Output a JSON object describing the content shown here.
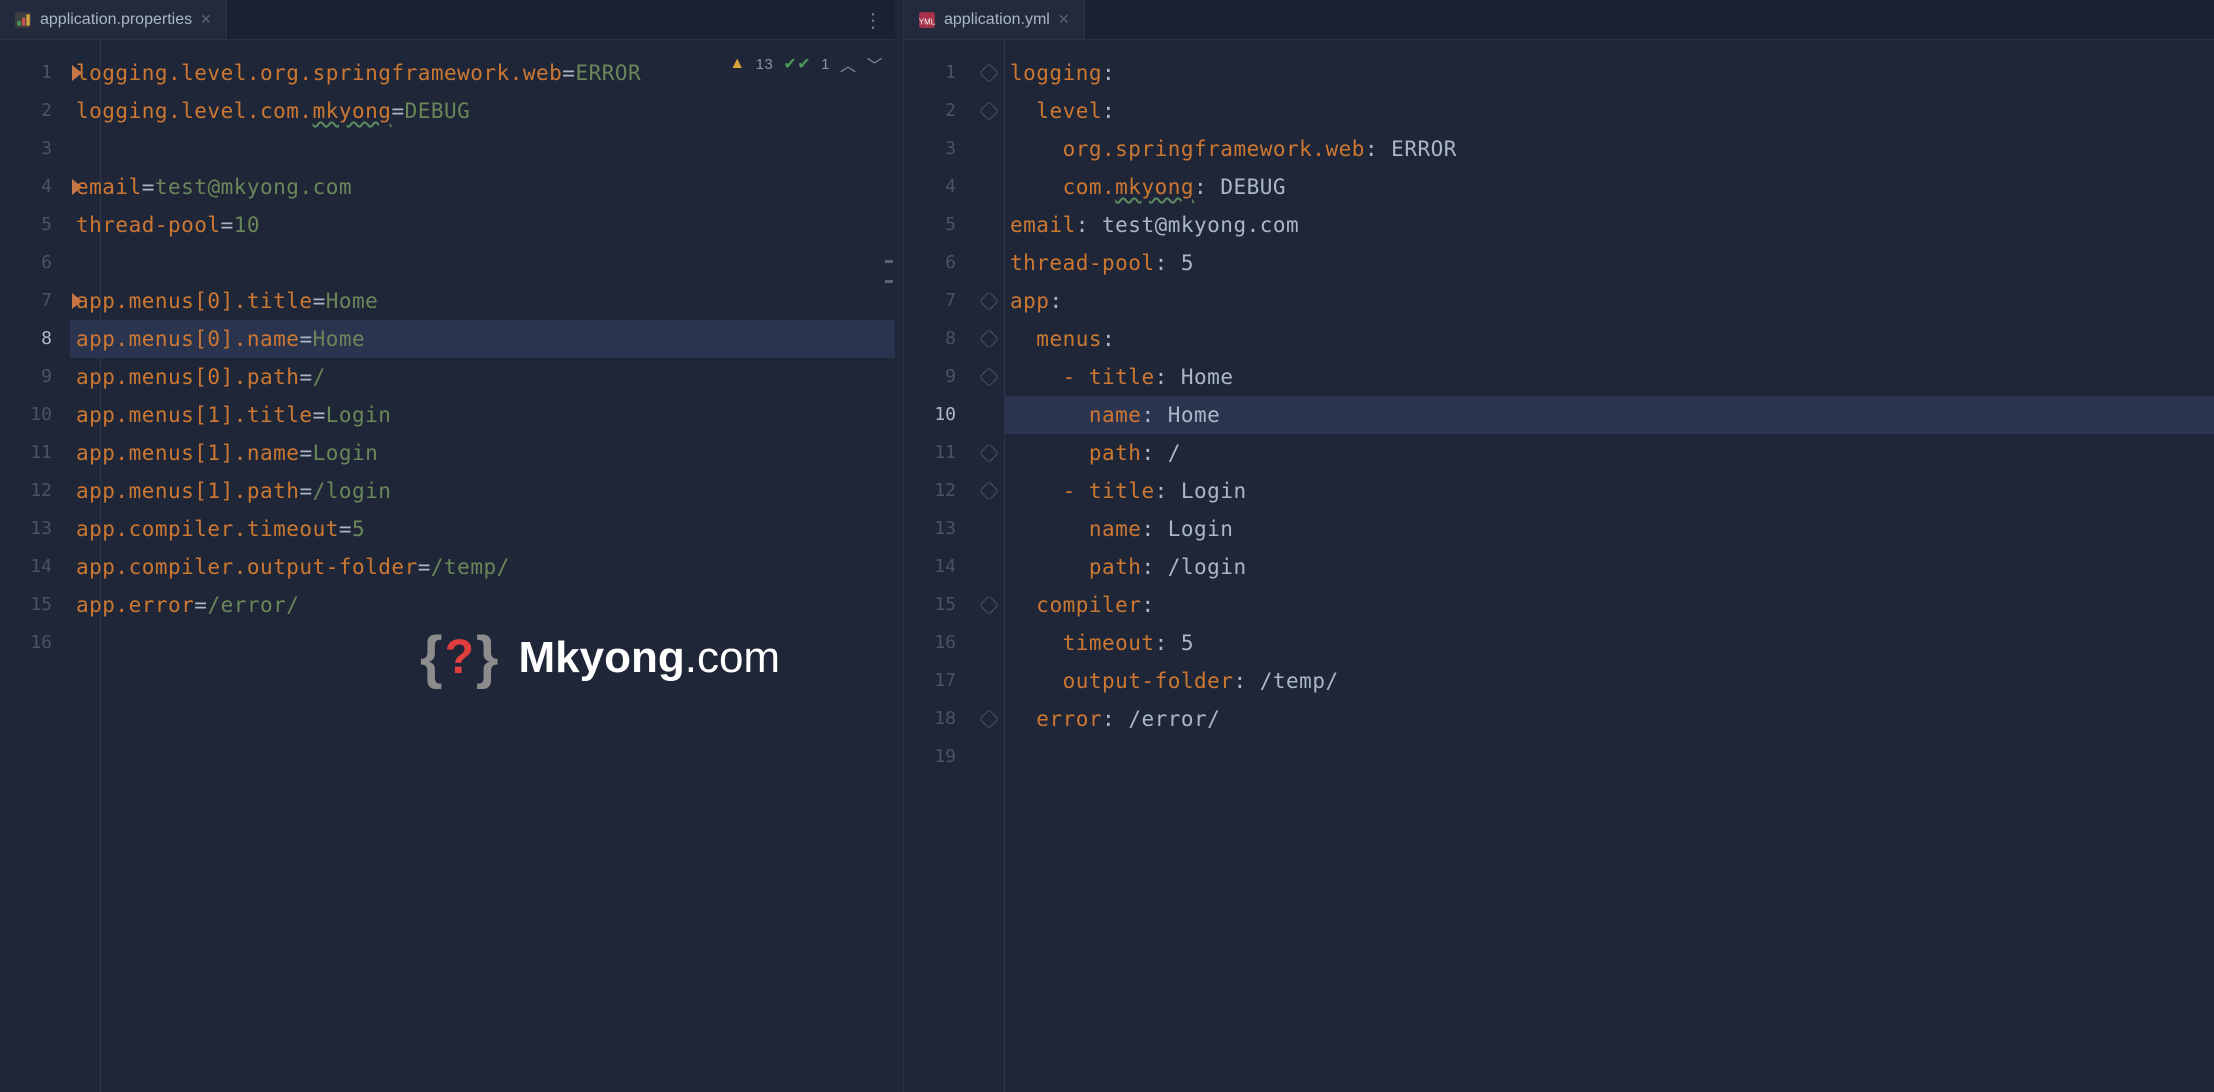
{
  "left": {
    "tab": {
      "filename": "application.properties"
    },
    "status": {
      "warn_count": "13",
      "ok_count": "1"
    },
    "bookmarks_at_lines": [
      1,
      4,
      7
    ],
    "active_line": 8,
    "lines": [
      {
        "n": 1,
        "tokens": [
          [
            "k-key",
            "logging.level.org.springframework.web"
          ],
          [
            "k-punct",
            "="
          ],
          [
            "k-val",
            "ERROR"
          ]
        ]
      },
      {
        "n": 2,
        "tokens": [
          [
            "k-key",
            "logging.level.com."
          ],
          [
            "k-key squiggle",
            "mkyong"
          ],
          [
            "k-punct",
            "="
          ],
          [
            "k-val",
            "DEBUG"
          ]
        ]
      },
      {
        "n": 3,
        "tokens": []
      },
      {
        "n": 4,
        "tokens": [
          [
            "k-key",
            "email"
          ],
          [
            "k-punct",
            "="
          ],
          [
            "k-val",
            "test@mkyong.com"
          ]
        ]
      },
      {
        "n": 5,
        "tokens": [
          [
            "k-key",
            "thread-pool"
          ],
          [
            "k-punct",
            "="
          ],
          [
            "k-val",
            "10"
          ]
        ]
      },
      {
        "n": 6,
        "tokens": []
      },
      {
        "n": 7,
        "tokens": [
          [
            "k-key",
            "app.menus[0].title"
          ],
          [
            "k-punct",
            "="
          ],
          [
            "k-val",
            "Home"
          ]
        ]
      },
      {
        "n": 8,
        "tokens": [
          [
            "k-key",
            "app.menus[0].name"
          ],
          [
            "k-punct",
            "="
          ],
          [
            "k-val",
            "Home"
          ]
        ]
      },
      {
        "n": 9,
        "tokens": [
          [
            "k-key",
            "app.menus[0].path"
          ],
          [
            "k-punct",
            "="
          ],
          [
            "k-val",
            "/"
          ]
        ]
      },
      {
        "n": 10,
        "tokens": [
          [
            "k-key",
            "app.menus[1].title"
          ],
          [
            "k-punct",
            "="
          ],
          [
            "k-val",
            "Login"
          ]
        ]
      },
      {
        "n": 11,
        "tokens": [
          [
            "k-key",
            "app.menus[1].name"
          ],
          [
            "k-punct",
            "="
          ],
          [
            "k-val",
            "Login"
          ]
        ]
      },
      {
        "n": 12,
        "tokens": [
          [
            "k-key",
            "app.menus[1].path"
          ],
          [
            "k-punct",
            "="
          ],
          [
            "k-val",
            "/login"
          ]
        ]
      },
      {
        "n": 13,
        "tokens": [
          [
            "k-key",
            "app.compiler.timeout"
          ],
          [
            "k-punct",
            "="
          ],
          [
            "k-val",
            "5"
          ]
        ]
      },
      {
        "n": 14,
        "tokens": [
          [
            "k-key",
            "app.compiler.output-folder"
          ],
          [
            "k-punct",
            "="
          ],
          [
            "k-val",
            "/temp/"
          ]
        ]
      },
      {
        "n": 15,
        "tokens": [
          [
            "k-key",
            "app.error"
          ],
          [
            "k-punct",
            "="
          ],
          [
            "k-val",
            "/error/"
          ]
        ]
      },
      {
        "n": 16,
        "tokens": []
      }
    ],
    "edge_ticks": [
      180,
      200
    ]
  },
  "right": {
    "tab": {
      "filename": "application.yml"
    },
    "active_line": 10,
    "fold_lines": [
      1,
      2,
      7,
      8,
      9,
      11,
      12,
      15,
      18
    ],
    "lines": [
      {
        "n": 1,
        "indent": 0,
        "tokens": [
          [
            "k-key",
            "logging"
          ],
          [
            "k-punct",
            ":"
          ]
        ]
      },
      {
        "n": 2,
        "indent": 1,
        "tokens": [
          [
            "k-key",
            "level"
          ],
          [
            "k-punct",
            ":"
          ]
        ]
      },
      {
        "n": 3,
        "indent": 2,
        "tokens": [
          [
            "k-key",
            "org.springframework.web"
          ],
          [
            "k-punct",
            ": "
          ],
          [
            "k-punct",
            "ERROR"
          ]
        ]
      },
      {
        "n": 4,
        "indent": 2,
        "tokens": [
          [
            "k-key",
            "com."
          ],
          [
            "k-key squiggle",
            "mkyong"
          ],
          [
            "k-punct",
            ": "
          ],
          [
            "k-punct",
            "DEBUG"
          ]
        ]
      },
      {
        "n": 5,
        "indent": 0,
        "tokens": [
          [
            "k-key",
            "email"
          ],
          [
            "k-punct",
            ": "
          ],
          [
            "k-punct",
            "test@mkyong.com"
          ]
        ]
      },
      {
        "n": 6,
        "indent": 0,
        "tokens": [
          [
            "k-key",
            "thread-pool"
          ],
          [
            "k-punct",
            ": "
          ],
          [
            "k-punct",
            "5"
          ]
        ]
      },
      {
        "n": 7,
        "indent": 0,
        "tokens": [
          [
            "k-key",
            "app"
          ],
          [
            "k-punct",
            ":"
          ]
        ]
      },
      {
        "n": 8,
        "indent": 1,
        "tokens": [
          [
            "k-key",
            "menus"
          ],
          [
            "k-punct",
            ":"
          ]
        ]
      },
      {
        "n": 9,
        "indent": 2,
        "tokens": [
          [
            "k-dash",
            "- "
          ],
          [
            "k-key",
            "title"
          ],
          [
            "k-punct",
            ": "
          ],
          [
            "k-punct",
            "Home"
          ]
        ]
      },
      {
        "n": 10,
        "indent": 3,
        "tokens": [
          [
            "k-key",
            "name"
          ],
          [
            "k-punct",
            ": "
          ],
          [
            "k-punct",
            "Home"
          ]
        ]
      },
      {
        "n": 11,
        "indent": 3,
        "tokens": [
          [
            "k-key",
            "path"
          ],
          [
            "k-punct",
            ": "
          ],
          [
            "k-punct",
            "/"
          ]
        ]
      },
      {
        "n": 12,
        "indent": 2,
        "tokens": [
          [
            "k-dash",
            "- "
          ],
          [
            "k-key",
            "title"
          ],
          [
            "k-punct",
            ": "
          ],
          [
            "k-punct",
            "Login"
          ]
        ]
      },
      {
        "n": 13,
        "indent": 3,
        "tokens": [
          [
            "k-key",
            "name"
          ],
          [
            "k-punct",
            ": "
          ],
          [
            "k-punct",
            "Login"
          ]
        ]
      },
      {
        "n": 14,
        "indent": 3,
        "tokens": [
          [
            "k-key",
            "path"
          ],
          [
            "k-punct",
            ": "
          ],
          [
            "k-punct",
            "/login"
          ]
        ]
      },
      {
        "n": 15,
        "indent": 1,
        "tokens": [
          [
            "k-key",
            "compiler"
          ],
          [
            "k-punct",
            ":"
          ]
        ]
      },
      {
        "n": 16,
        "indent": 2,
        "tokens": [
          [
            "k-key",
            "timeout"
          ],
          [
            "k-punct",
            ": "
          ],
          [
            "k-punct",
            "5"
          ]
        ]
      },
      {
        "n": 17,
        "indent": 2,
        "tokens": [
          [
            "k-key",
            "output-folder"
          ],
          [
            "k-punct",
            ": "
          ],
          [
            "k-punct",
            "/temp/"
          ]
        ]
      },
      {
        "n": 18,
        "indent": 1,
        "tokens": [
          [
            "k-key",
            "error"
          ],
          [
            "k-punct",
            ": "
          ],
          [
            "k-punct",
            "/error/"
          ]
        ]
      },
      {
        "n": 19,
        "indent": 0,
        "tokens": []
      }
    ]
  },
  "watermark": {
    "brand": "Mkyong",
    "suffix": ".com",
    "q": "?"
  }
}
